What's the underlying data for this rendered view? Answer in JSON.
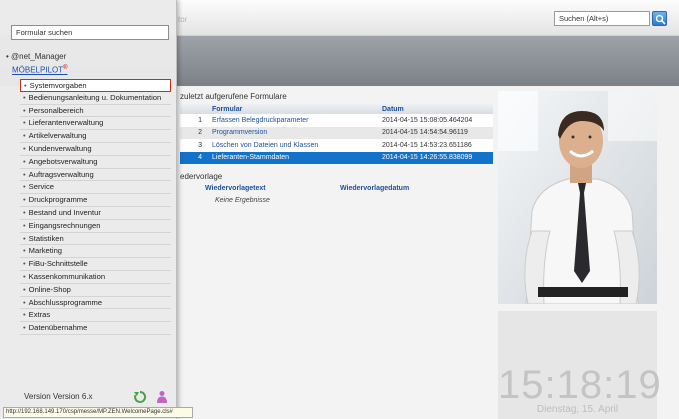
{
  "topbar": {
    "ghost_text": "tor",
    "search_placeholder": "Suchen (Alt+s)"
  },
  "menu": {
    "form_search_placeholder": "Formular suchen",
    "tree_root": "@net_Manager",
    "tree_product": "MÖBELPILOT",
    "tree_product_mark": "®",
    "items": [
      {
        "label": "Systemvorgaben"
      },
      {
        "label": "Bedienungsanleitung u. Dokumentation"
      },
      {
        "label": "Personalbereich"
      },
      {
        "label": "Lieferantenverwaltung"
      },
      {
        "label": "Artikelverwaltung"
      },
      {
        "label": "Kundenverwaltung"
      },
      {
        "label": "Angebotsverwaltung"
      },
      {
        "label": "Auftragsverwaltung"
      },
      {
        "label": "Service"
      },
      {
        "label": "Druckprogramme"
      },
      {
        "label": "Bestand und Inventur"
      },
      {
        "label": "Eingangsrechnungen"
      },
      {
        "label": "Statistiken"
      },
      {
        "label": "Marketing"
      },
      {
        "label": "FiBu-Schnittstelle"
      },
      {
        "label": "Kassenkommunikation"
      },
      {
        "label": "Online-Shop"
      },
      {
        "label": "Abschlussprogramme"
      },
      {
        "label": "Extras"
      },
      {
        "label": "Datenübernahme"
      }
    ],
    "version_text": "Version Version 6.x",
    "status_url": "http://192.168.149.170/csp/messe/MP.ZEN.WelcomePage.cls#"
  },
  "recent": {
    "title": "zuletzt aufgerufene Formulare",
    "columns": [
      "",
      "Formular",
      "Datum"
    ],
    "rows": [
      {
        "num": "1",
        "form": "Erfassen Belegdruckparameter",
        "date": "2014-04-15 15:08:05.464204"
      },
      {
        "num": "2",
        "form": "Programmversion",
        "date": "2014-04-15 14:54:54.96119"
      },
      {
        "num": "3",
        "form": "Löschen von Dateien und Klassen",
        "date": "2014-04-15 14:53:23.651186"
      },
      {
        "num": "4",
        "form": "Lieferanten-Stammdaten",
        "date": "2014-04-15 14:26:55.838099"
      }
    ]
  },
  "wiedervorlage": {
    "title": "edervorlage",
    "col_text": "Wiedervorlagetext",
    "col_date": "Wiedervorlagedatum",
    "empty": "Keine Ergebnisse"
  },
  "clock": {
    "time": "15:18:19",
    "date": "Dienstag, 15. April"
  },
  "colors": {
    "accent": "#1372c9",
    "active_border": "#cc2b1d",
    "link": "#1f4f9a"
  }
}
